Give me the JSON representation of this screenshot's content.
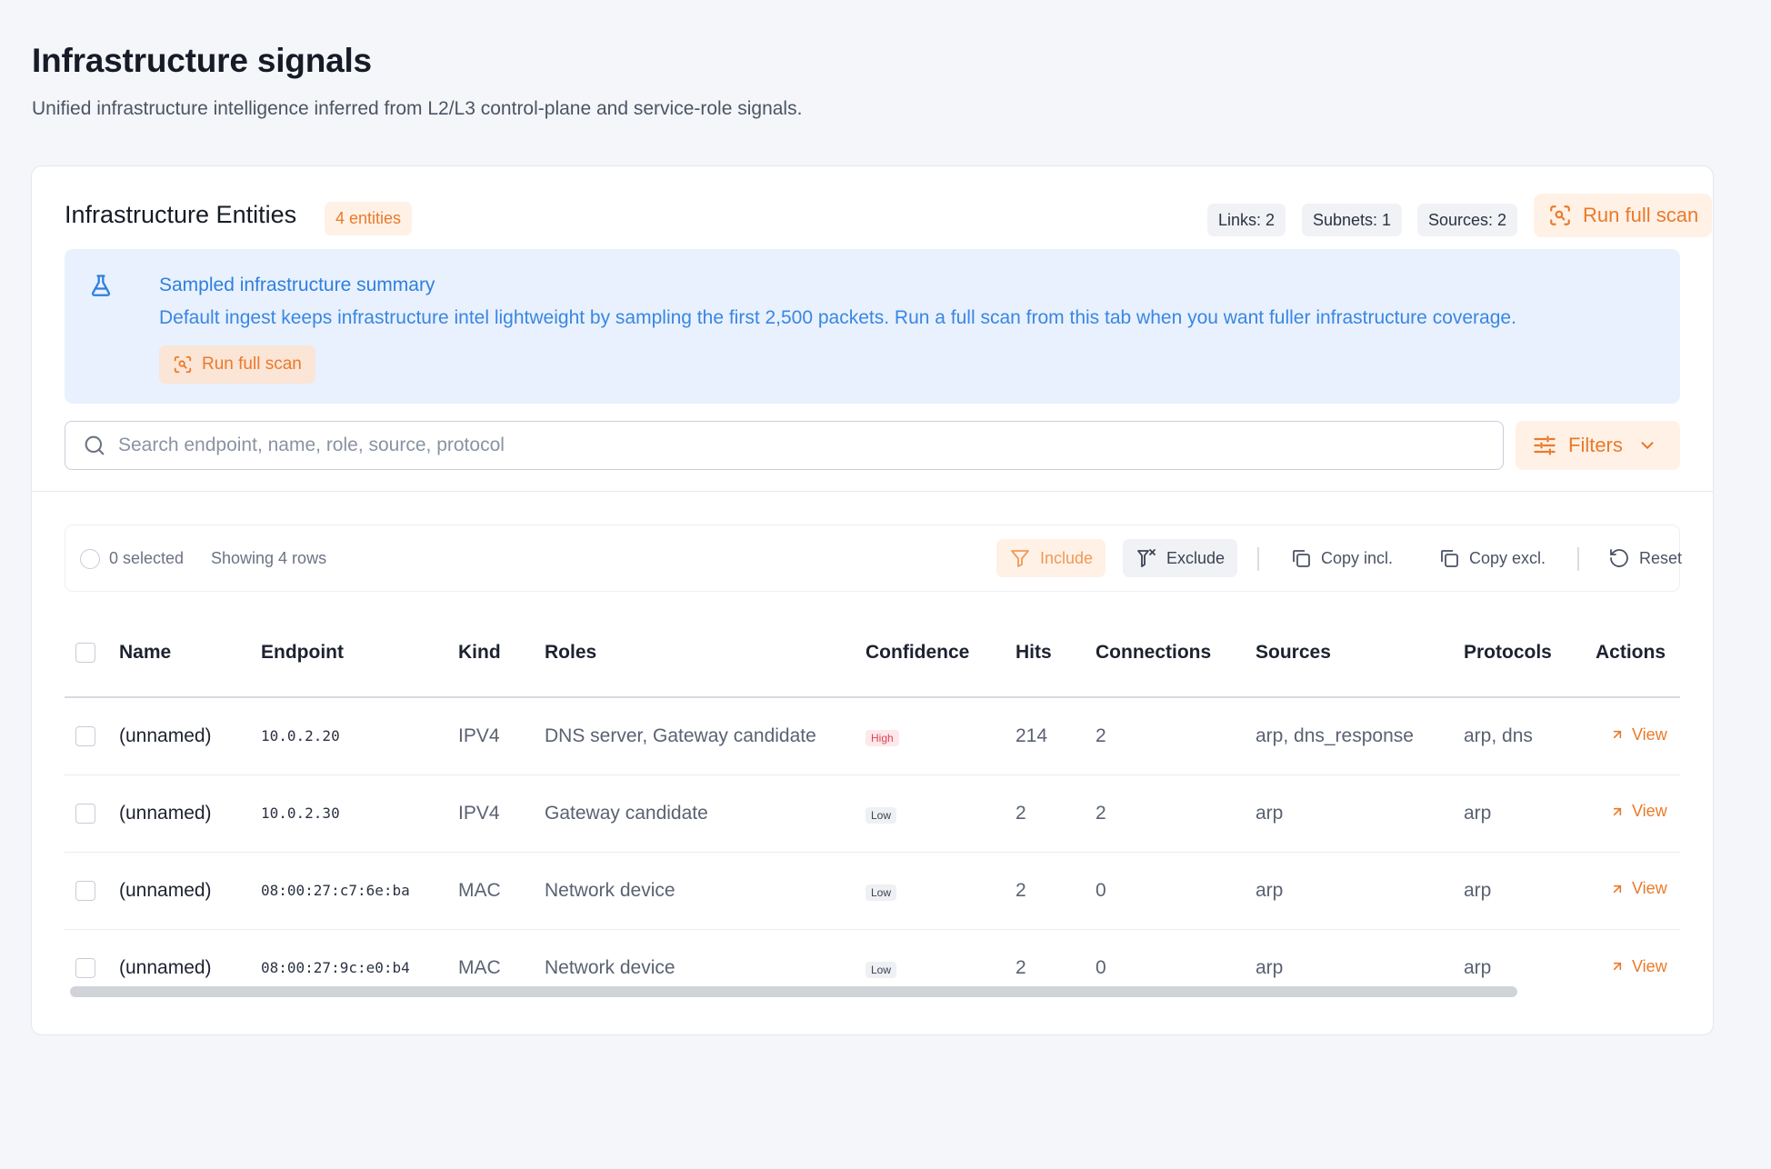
{
  "page": {
    "title": "Infrastructure signals",
    "subtitle": "Unified infrastructure intelligence inferred from L2/L3 control-plane and service-role signals."
  },
  "card": {
    "title": "Infrastructure Entities",
    "entity_count": "4 entities",
    "stats": [
      "Links: 2",
      "Subnets: 1",
      "Sources: 2"
    ],
    "run_full_scan_label": "Run full scan"
  },
  "summary": {
    "title": "Sampled infrastructure summary",
    "text": "Default ingest keeps infrastructure intel lightweight by sampling the first 2,500 packets. Run a full scan from this tab when you want fuller infrastructure coverage.",
    "button_label": "Run full scan"
  },
  "search": {
    "placeholder": "Search endpoint, name, role, source, protocol",
    "value": ""
  },
  "filters": {
    "label": "Filters"
  },
  "toolbar": {
    "selected": "0 selected",
    "showing": "Showing 4 rows",
    "include": "Include",
    "exclude": "Exclude",
    "copy_incl": "Copy incl.",
    "copy_excl": "Copy excl.",
    "reset": "Reset"
  },
  "table": {
    "columns": [
      "Name",
      "Endpoint",
      "Kind",
      "Roles",
      "Confidence",
      "Hits",
      "Connections",
      "Sources",
      "Protocols",
      "Actions"
    ],
    "rows": [
      {
        "name": "(unnamed)",
        "endpoint": "10.0.2.20",
        "kind": "IPV4",
        "roles": "DNS server, Gateway candidate",
        "confidence": "High",
        "hits": "214",
        "connections": "2",
        "sources": "arp, dns_response",
        "protocols": "arp, dns",
        "action": "View"
      },
      {
        "name": "(unnamed)",
        "endpoint": "10.0.2.30",
        "kind": "IPV4",
        "roles": "Gateway candidate",
        "confidence": "Low",
        "hits": "2",
        "connections": "2",
        "sources": "arp",
        "protocols": "arp",
        "action": "View"
      },
      {
        "name": "(unnamed)",
        "endpoint": "08:00:27:c7:6e:ba",
        "kind": "MAC",
        "roles": "Network device",
        "confidence": "Low",
        "hits": "2",
        "connections": "0",
        "sources": "arp",
        "protocols": "arp",
        "action": "View"
      },
      {
        "name": "(unnamed)",
        "endpoint": "08:00:27:9c:e0:b4",
        "kind": "MAC",
        "roles": "Network device",
        "confidence": "Low",
        "hits": "2",
        "connections": "0",
        "sources": "arp",
        "protocols": "arp",
        "action": "View"
      }
    ]
  },
  "colors": {
    "accent": "#ea7a2a",
    "info_bg": "#e8f1fd",
    "info_text": "#2f7fdf",
    "high_badge": "#e0435a"
  },
  "icons": {
    "run_scan": "scan-search-icon",
    "summary": "flask-icon",
    "search": "search-icon",
    "filters": "sliders-icon",
    "include": "filter-icon",
    "exclude": "filter-x-icon",
    "copy": "copy-icon",
    "reset": "rotate-ccw-icon",
    "view": "arrow-up-right-icon"
  }
}
